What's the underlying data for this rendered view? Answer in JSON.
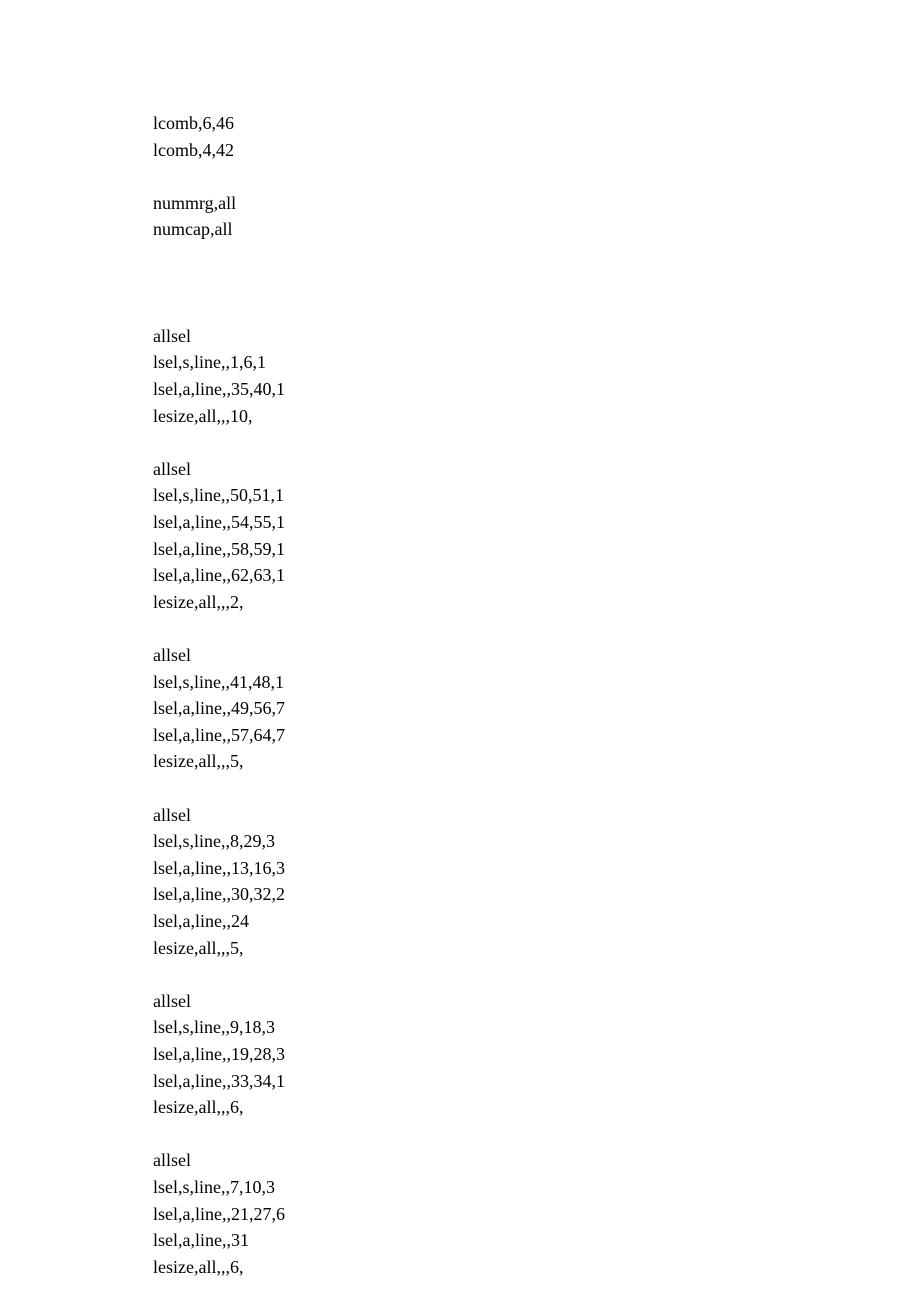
{
  "blocks": [
    [
      "lcomb,6,46",
      "lcomb,4,42"
    ],
    [
      "nummrg,all",
      "numcap,all"
    ],
    [
      ""
    ],
    [
      "allsel",
      "lsel,s,line,,1,6,1",
      "lsel,a,line,,35,40,1",
      "lesize,all,,,10,"
    ],
    [
      "allsel",
      "lsel,s,line,,50,51,1",
      "lsel,a,line,,54,55,1",
      "lsel,a,line,,58,59,1",
      "lsel,a,line,,62,63,1",
      "lesize,all,,,2,"
    ],
    [
      "allsel",
      "lsel,s,line,,41,48,1",
      "lsel,a,line,,49,56,7",
      "lsel,a,line,,57,64,7",
      "lesize,all,,,5,"
    ],
    [
      "allsel",
      "lsel,s,line,,8,29,3",
      "lsel,a,line,,13,16,3",
      "lsel,a,line,,30,32,2",
      "lsel,a,line,,24",
      "lesize,all,,,5,"
    ],
    [
      "allsel",
      "lsel,s,line,,9,18,3",
      "lsel,a,line,,19,28,3",
      "lsel,a,line,,33,34,1",
      "lesize,all,,,6,"
    ],
    [
      "allsel",
      "lsel,s,line,,7,10,3",
      "lsel,a,line,,21,27,6",
      "lsel,a,line,,31",
      "lesize,all,,,6,"
    ]
  ]
}
